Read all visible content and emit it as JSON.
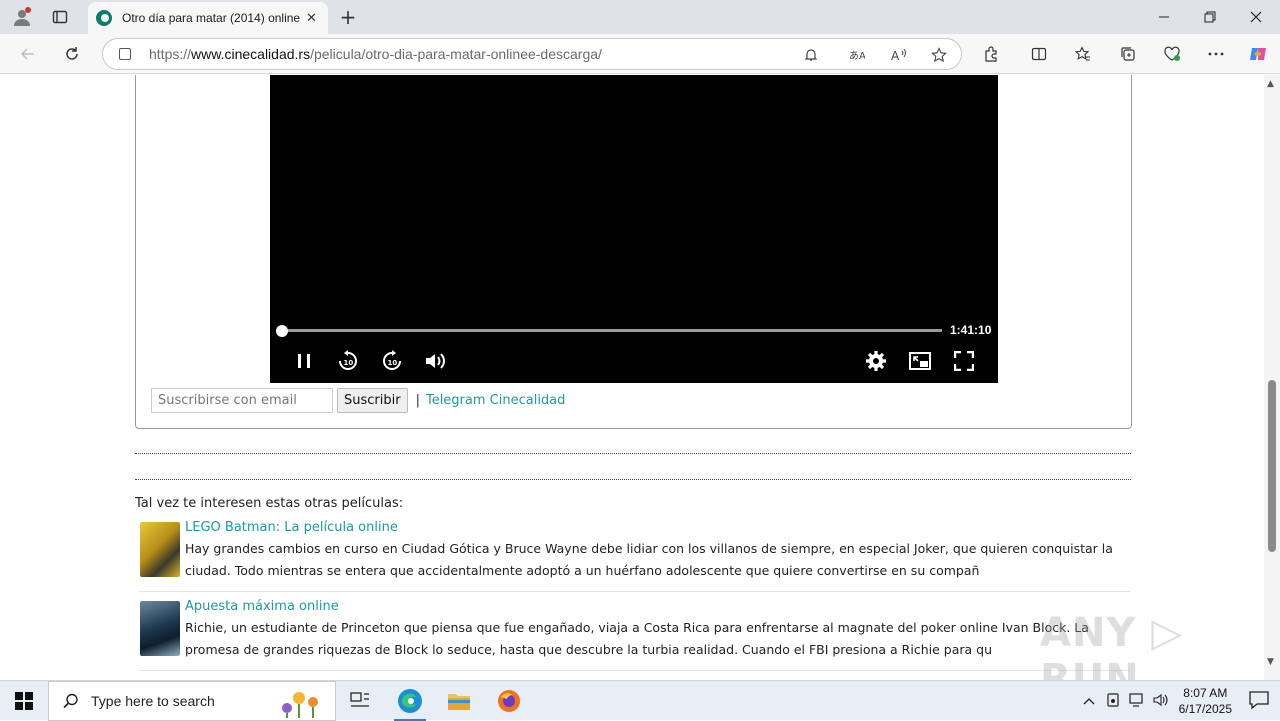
{
  "browser": {
    "tab_title": "Otro día para matar (2014) online",
    "tab_close": "✕",
    "new_tab": "+",
    "url_prefix": "https://",
    "url_domain": "www.cinecalidad.rs",
    "url_path": "/pelicula/otro-dia-para-matar-onlinee-descarga/",
    "window_controls": [
      "minimize",
      "restore",
      "close"
    ]
  },
  "player": {
    "duration": "1:41:10",
    "progress_fraction": 0.0,
    "state": "playing"
  },
  "subscribe": {
    "email_placeholder": "Suscribirse con email",
    "button_label": "Suscribir",
    "separator": "|",
    "telegram_link": "Telegram Cinecalidad"
  },
  "related": {
    "heading": "Tal vez te interesen estas otras películas:",
    "items": [
      {
        "title": "LEGO Batman: La película online",
        "description": "Hay grandes cambios en curso en Ciudad Gótica y Bruce Wayne debe lidiar con los villanos de siempre, en especial Joker, que quieren conquistar la ciudad. Todo mientras se entera que accidentalmente adoptó a un huérfano adolescente que quiere convertirse en su compañ",
        "thumb_color": "#d9b62a"
      },
      {
        "title": "Apuesta máxima online",
        "description": "Richie, un estudiante de Princeton que piensa que fue engañado, viaja a Costa Rica para enfrentarse al magnate del poker online Ivan Block. La promesa de grandes riquezas de Block lo seduce, hasta que descubre la turbia realidad. Cuando el FBI presiona a Richie para qu",
        "thumb_color": "#2c5c7a"
      }
    ]
  },
  "watermark": "ANY RUN",
  "taskbar": {
    "search_placeholder": "Type here to search",
    "time": "8:07 AM",
    "date": "6/17/2025"
  }
}
